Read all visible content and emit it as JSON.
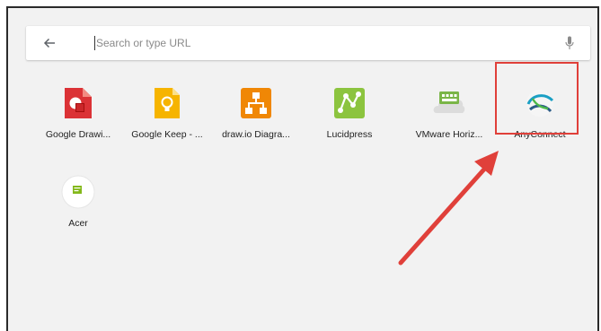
{
  "search": {
    "placeholder": "Search or type URL"
  },
  "apps": [
    {
      "label": "Google Drawi...",
      "icon": "google-drawings-icon",
      "color": "#db3236"
    },
    {
      "label": "Google Keep - ...",
      "icon": "google-keep-icon",
      "color": "#f6b400"
    },
    {
      "label": "draw.io Diagra...",
      "icon": "drawio-icon",
      "color": "#f08705"
    },
    {
      "label": "Lucidpress",
      "icon": "lucidpress-icon",
      "color": "#8cc43f"
    },
    {
      "label": "VMware Horiz...",
      "icon": "vmware-horizon-icon",
      "color": "#7ab547"
    },
    {
      "label": "AnyConnect",
      "icon": "anyconnect-icon",
      "color": "#1a9fc4"
    },
    {
      "label": "Acer",
      "icon": "acer-icon",
      "color": "#83b81a"
    }
  ],
  "annotation": {
    "highlight_color": "#e0403a",
    "highlighted_app": "AnyConnect"
  }
}
